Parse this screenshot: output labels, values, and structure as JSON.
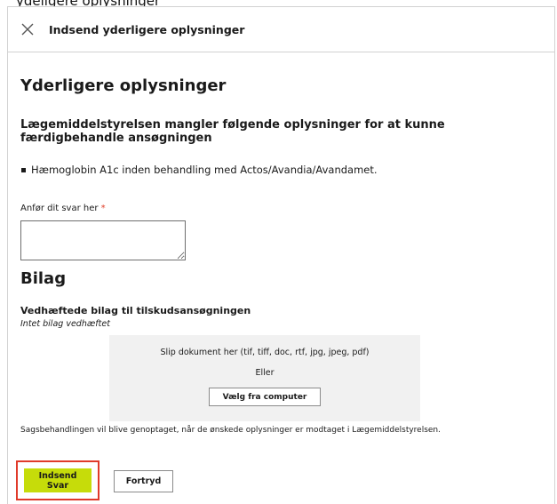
{
  "page_header_partial": "ydeligere oplysninger",
  "dialog": {
    "title": "Indsend yderligere oplysninger",
    "close_icon": "close-icon"
  },
  "main": {
    "heading": "Yderligere oplysninger",
    "subheading": "Lægemiddelstyrelsen mangler følgende oplysninger for at kunne færdigbehandle ansøgningen",
    "missing_items": [
      "Hæmoglobin A1c inden behandling med Actos/Avandia/Avandamet."
    ],
    "answer_field": {
      "label": "Anfør dit svar her",
      "required_mark": "*",
      "value": ""
    }
  },
  "attachments": {
    "heading": "Bilag",
    "subheading": "Vedhæftede bilag til tilskudsansøgningen",
    "empty_text": "Intet bilag vedhæftet",
    "dropzone_text": "Slip dokument her (tif, tiff, doc, rtf, jpg, jpeg, pdf)",
    "or_text": "Eller",
    "choose_button": "Vælg fra computer"
  },
  "note": "Sagsbehandlingen vil blive genoptaget, når de ønskede oplysninger er modtaget i Lægemiddelstyrelsen.",
  "footer": {
    "submit_label": "Indsend Svar",
    "cancel_label": "Fortryd"
  },
  "colors": {
    "accent": "#c6dc0a",
    "focus_ring": "#e03a2a",
    "required": "#e0402a",
    "dropzone_bg": "#f1f1f1"
  }
}
